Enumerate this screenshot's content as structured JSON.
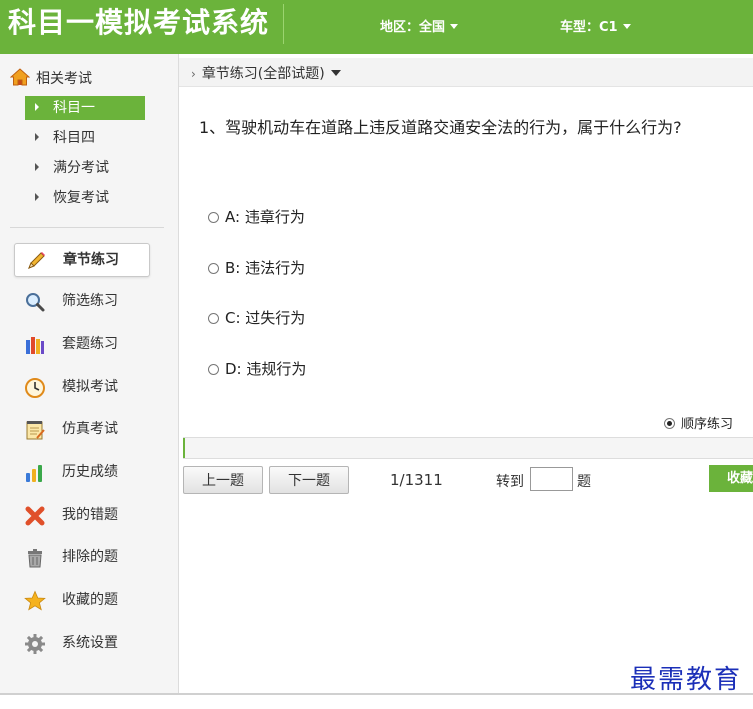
{
  "header": {
    "app_title": "科目一模拟考试系统",
    "region_label": "地区：全国",
    "cartype_label": "车型：C1"
  },
  "sidebar": {
    "heading": "相关考试",
    "exams": [
      {
        "label": "科目一",
        "active": true
      },
      {
        "label": "科目四",
        "active": false
      },
      {
        "label": "满分考试",
        "active": false
      },
      {
        "label": "恢复考试",
        "active": false
      }
    ],
    "nav": [
      {
        "label": "章节练习",
        "icon": "pencil-icon",
        "active": true
      },
      {
        "label": "筛选练习",
        "icon": "magnifier-icon"
      },
      {
        "label": "套题练习",
        "icon": "books-icon"
      },
      {
        "label": "模拟考试",
        "icon": "clock-icon"
      },
      {
        "label": "仿真考试",
        "icon": "notepad-icon"
      },
      {
        "label": "历史成绩",
        "icon": "bar-chart-icon"
      },
      {
        "label": "我的错题",
        "icon": "x-mark-icon"
      },
      {
        "label": "排除的题",
        "icon": "trash-icon"
      },
      {
        "label": "收藏的题",
        "icon": "star-icon"
      },
      {
        "label": "系统设置",
        "icon": "gear-icon"
      }
    ]
  },
  "main": {
    "breadcrumb": "章节练习(全部试题)",
    "question": "1、驾驶机动车在道路上违反道路交通安全法的行为，属于什么行为?",
    "options": [
      "A: 违章行为",
      "B: 违法行为",
      "C: 过失行为",
      "D: 违规行为"
    ],
    "mode_label": "顺序练习",
    "progress": 0.001,
    "prev_label": "上一题",
    "next_label": "下一题",
    "counter": "1/1311",
    "goto_label": "转到",
    "goto_unit": "题",
    "goto_value": "",
    "favorite_label": "收藏"
  },
  "watermark": "最需教育",
  "colors": {
    "brand_green": "#6bb33b",
    "watermark_blue": "#1b2fb8"
  }
}
